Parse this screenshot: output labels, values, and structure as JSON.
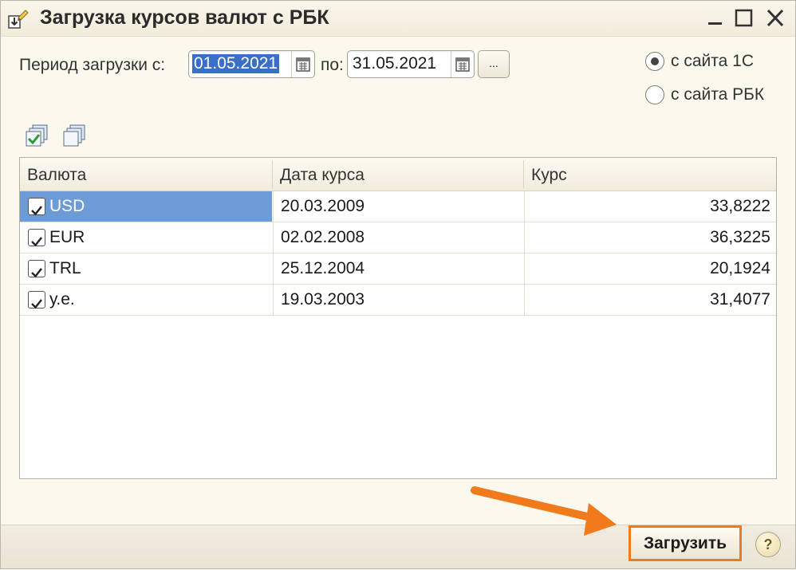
{
  "window": {
    "title": "Загрузка курсов валют с РБК"
  },
  "period": {
    "from_label": "Период загрузки с:",
    "from_value": "01.05.2021",
    "to_label": "по:",
    "to_value": "31.05.2021",
    "more_label": "..."
  },
  "source": {
    "option_1c": "с сайта 1С",
    "option_rbk": "с сайта РБК",
    "selected": "option_1c"
  },
  "table": {
    "columns": [
      "Валюта",
      "Дата курса",
      "Курс"
    ],
    "rows": [
      {
        "currency": "USD",
        "date": "20.03.2009",
        "rate": "33,8222",
        "checked": true
      },
      {
        "currency": "EUR",
        "date": "02.02.2008",
        "rate": "36,3225",
        "checked": true
      },
      {
        "currency": "TRL",
        "date": "25.12.2004",
        "rate": "20,1924",
        "checked": true
      },
      {
        "currency": "у.е.",
        "date": "19.03.2003",
        "rate": "31,4077",
        "checked": true
      }
    ]
  },
  "footer": {
    "load_label": "Загрузить",
    "help_label": "?"
  },
  "colors": {
    "selection": "#6d9bd6",
    "highlight": "#f07a1c",
    "background": "#fbf8ee"
  }
}
